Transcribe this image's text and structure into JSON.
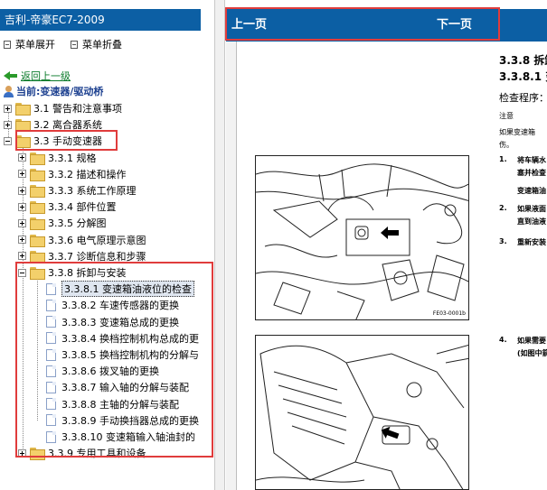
{
  "left_pane": {
    "title": "吉利-帝豪EC7-2009",
    "expand_menu": "菜单展开",
    "collapse_menu": "菜单折叠",
    "back_link": "返回上一级",
    "current_label": "当前:变速器/驱动桥",
    "tree": [
      {
        "label": "3.1 警告和注意事项",
        "state": "collapsed",
        "level": 0
      },
      {
        "label": "3.2 离合器系统",
        "state": "collapsed",
        "level": 0
      },
      {
        "label": "3.3 手动变速器",
        "state": "expanded",
        "level": 0
      },
      {
        "label": "3.3.1 规格",
        "state": "collapsed",
        "level": 1
      },
      {
        "label": "3.3.2 描述和操作",
        "state": "collapsed",
        "level": 1
      },
      {
        "label": "3.3.3 系统工作原理",
        "state": "collapsed",
        "level": 1
      },
      {
        "label": "3.3.4 部件位置",
        "state": "collapsed",
        "level": 1
      },
      {
        "label": "3.3.5 分解图",
        "state": "collapsed",
        "level": 1
      },
      {
        "label": "3.3.6 电气原理示意图",
        "state": "collapsed",
        "level": 1
      },
      {
        "label": "3.3.7 诊断信息和步骤",
        "state": "collapsed",
        "level": 1
      },
      {
        "label": "3.3.8 拆卸与安装",
        "state": "expanded",
        "level": 1
      },
      {
        "label": "3.3.8.1 变速箱油液位的检查",
        "state": "page",
        "level": 2,
        "selected": true
      },
      {
        "label": "3.3.8.2 车速传感器的更换",
        "state": "page",
        "level": 2
      },
      {
        "label": "3.3.8.3 变速箱总成的更换",
        "state": "page",
        "level": 2
      },
      {
        "label": "3.3.8.4 换档控制机构总成的更",
        "state": "page",
        "level": 2
      },
      {
        "label": "3.3.8.5 换档控制机构的分解与",
        "state": "page",
        "level": 2
      },
      {
        "label": "3.3.8.6 拨叉轴的更换",
        "state": "page",
        "level": 2
      },
      {
        "label": "3.3.8.7 输入轴的分解与装配",
        "state": "page",
        "level": 2
      },
      {
        "label": "3.3.8.8 主轴的分解与装配",
        "state": "page",
        "level": 2
      },
      {
        "label": "3.3.8.9 手动换挡器总成的更换",
        "state": "page",
        "level": 2
      },
      {
        "label": "3.3.8.10 变速箱输入轴油封的",
        "state": "page",
        "level": 2
      },
      {
        "label": "3.3.9 专用工具和设备",
        "state": "collapsed",
        "level": 1
      }
    ]
  },
  "nav": {
    "prev": "上一页",
    "next": "下一页"
  },
  "document": {
    "section": "3.3.8 拆卸",
    "subsection": "3.3.8.1 变",
    "procedure": "检查程序：",
    "caution": "注意",
    "caution_text_1": "如果变速箱",
    "caution_text_2": "伤。",
    "steps": [
      {
        "num": "1.",
        "lines": [
          "将车辆水",
          "塞并检查",
          "变速箱油"
        ]
      },
      {
        "num": "2.",
        "lines": [
          "如果液面",
          "直到油液"
        ]
      },
      {
        "num": "3.",
        "lines": [
          "重新安装"
        ]
      },
      {
        "num": "4.",
        "lines": [
          "如果需要",
          "(如图中箭"
        ]
      }
    ],
    "figure_1_id": "FE03-0001b"
  },
  "colors": {
    "title_bar": "#0c5fa4",
    "highlight_box": "#e03c3c",
    "back_link": "#0a7a2a"
  }
}
